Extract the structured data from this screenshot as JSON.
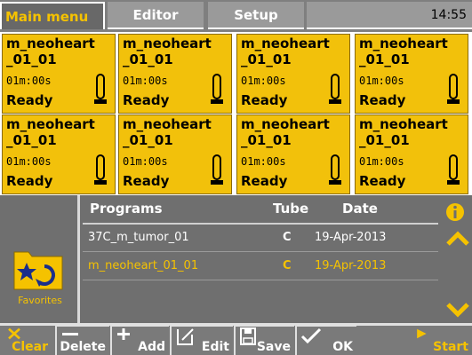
{
  "tabs": [
    {
      "label": "Main menu",
      "active": true
    },
    {
      "label": "Editor",
      "active": false
    },
    {
      "label": "Setup",
      "active": false
    }
  ],
  "clock": "14:55",
  "blocks": [
    {
      "name1": "m_neoheart",
      "name2": "_01_01",
      "time": "01m:00s",
      "status": "Ready"
    },
    {
      "name1": "m_neoheart",
      "name2": "_01_01",
      "time": "01m:00s",
      "status": "Ready"
    },
    {
      "name1": "m_neoheart",
      "name2": "_01_01",
      "time": "01m:00s",
      "status": "Ready"
    },
    {
      "name1": "m_neoheart",
      "name2": "_01_01",
      "time": "01m:00s",
      "status": "Ready"
    },
    {
      "name1": "m_neoheart",
      "name2": "_01_01",
      "time": "01m:00s",
      "status": "Ready"
    },
    {
      "name1": "m_neoheart",
      "name2": "_01_01",
      "time": "01m:00s",
      "status": "Ready"
    },
    {
      "name1": "m_neoheart",
      "name2": "_01_01",
      "time": "01m:00s",
      "status": "Ready"
    },
    {
      "name1": "m_neoheart",
      "name2": "_01_01",
      "time": "01m:00s",
      "status": "Ready"
    }
  ],
  "favorites": {
    "label": "Favorites",
    "icon": "favorites-folder-icon"
  },
  "programs": {
    "headers": {
      "programs": "Programs",
      "tube": "Tube",
      "date": "Date"
    },
    "rows": [
      {
        "name": "37C_m_tumor_01",
        "tube": "C",
        "date": "19-Apr-2013",
        "selected": false
      },
      {
        "name": "m_neoheart_01_01",
        "tube": "C",
        "date": "19-Apr-2013",
        "selected": true
      }
    ]
  },
  "toolbar": {
    "clear": "Clear",
    "delete": "Delete",
    "add": "Add",
    "edit": "Edit",
    "save": "Save",
    "ok": "OK",
    "start": "Start"
  },
  "colors": {
    "accent": "#f5c200",
    "block": "#f2c10b",
    "panel": "#6f6f6f"
  }
}
